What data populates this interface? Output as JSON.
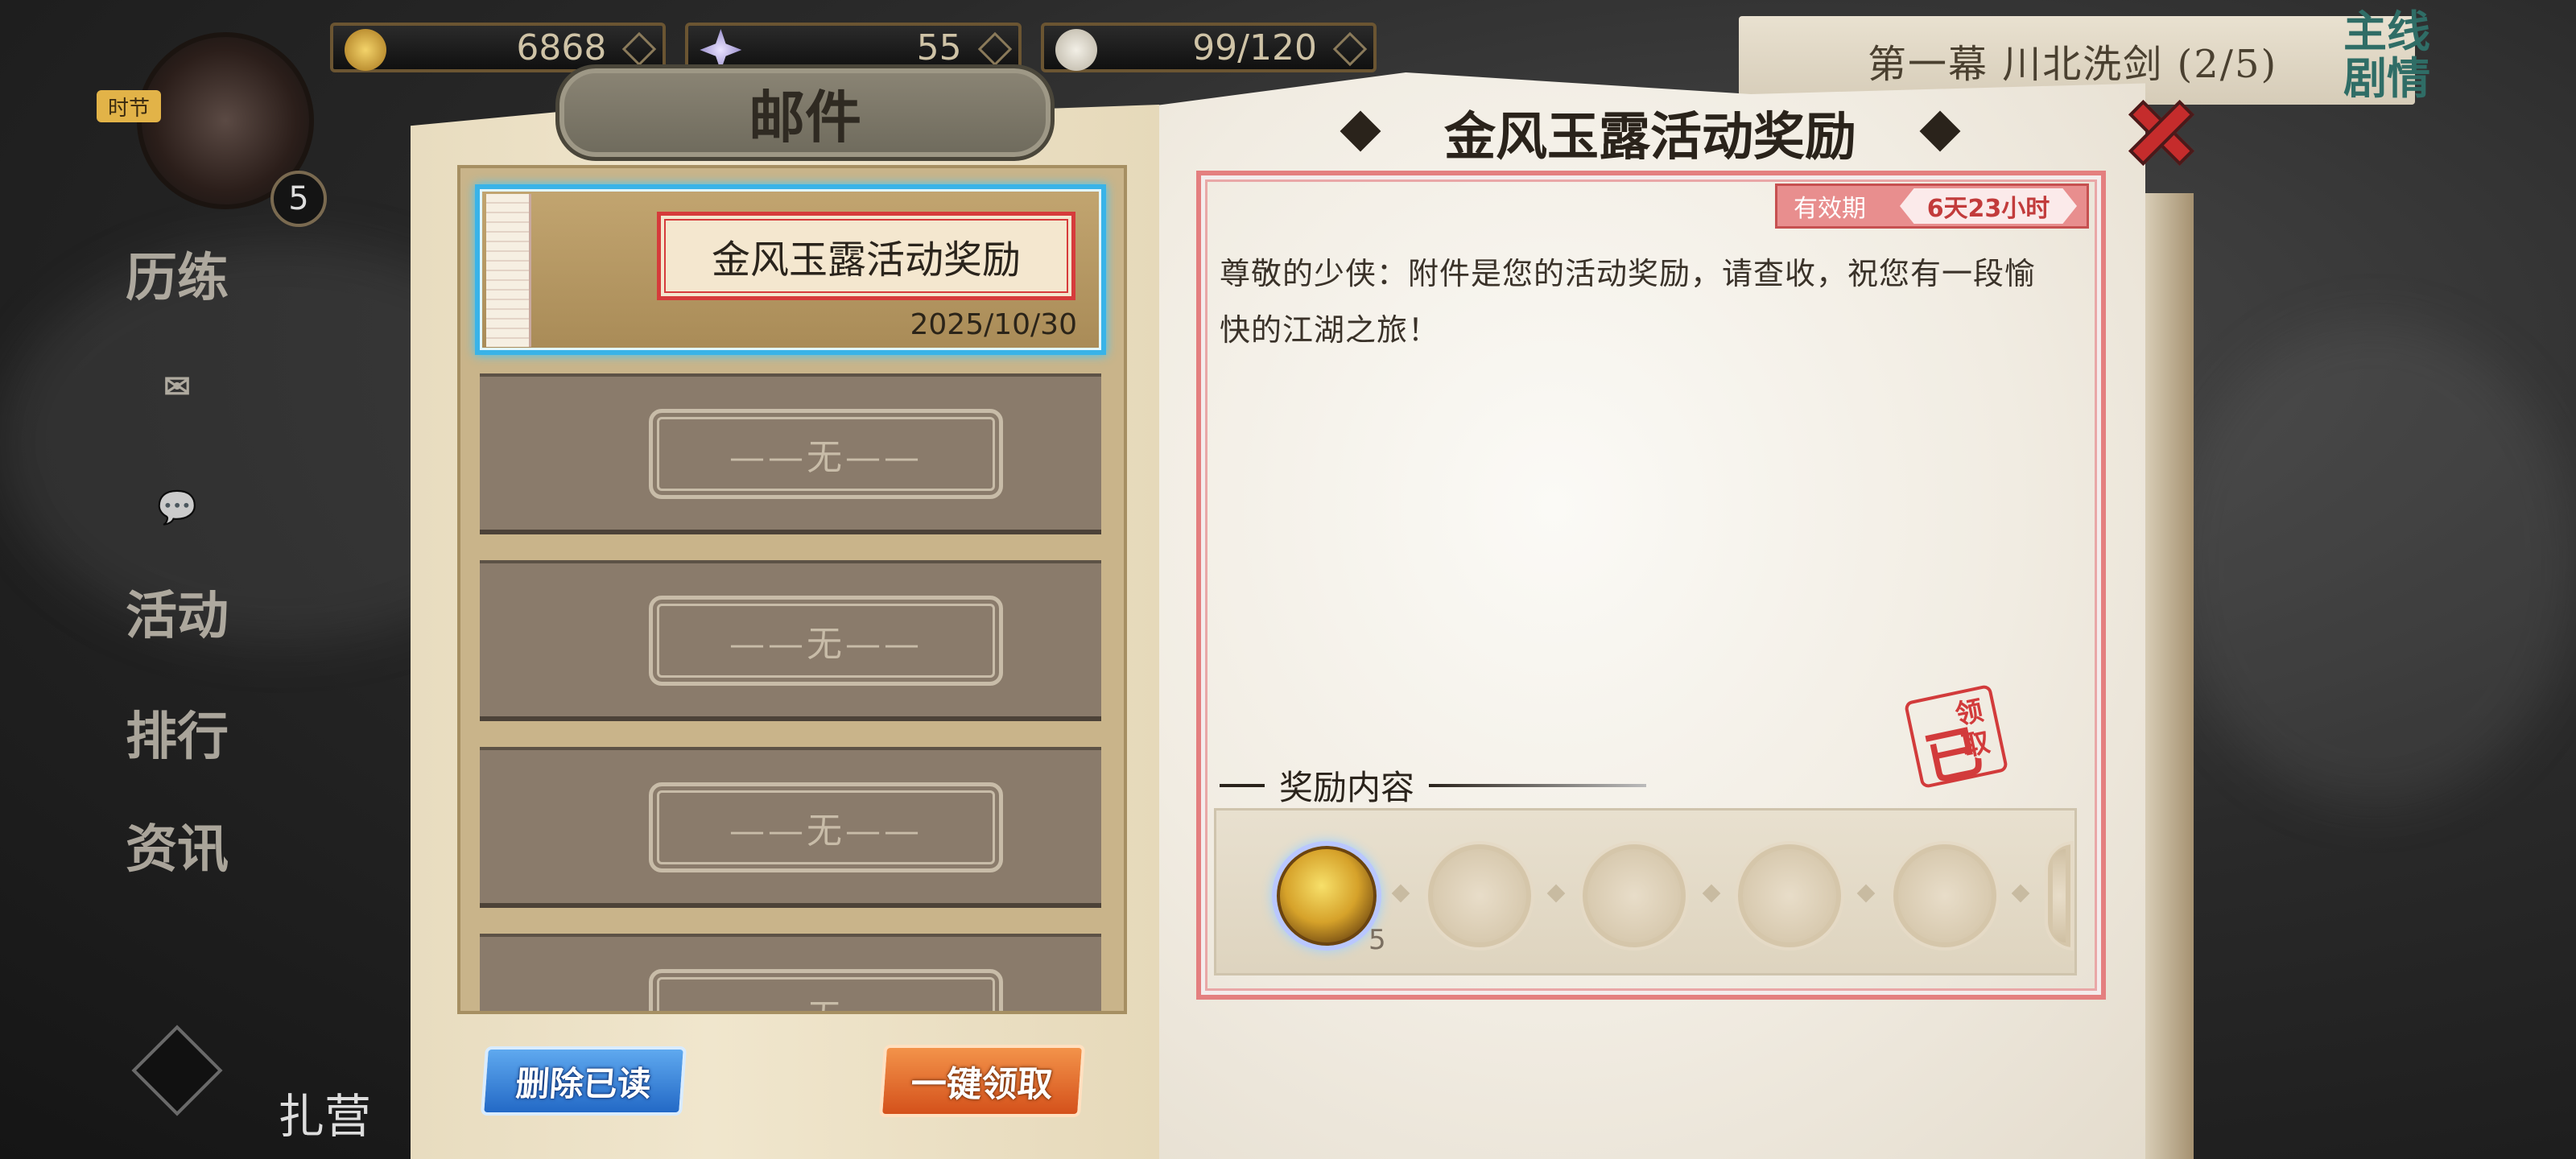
{
  "top_resources": [
    {
      "icon": "coins-icon",
      "value": "6868"
    },
    {
      "icon": "star-crystal-icon",
      "value": "55"
    },
    {
      "icon": "stamina-icon",
      "value": "99/120"
    }
  ],
  "player": {
    "level": "5",
    "time_tag": "时节"
  },
  "side_menu": [
    "历练",
    "信",
    "活动",
    "排行",
    "资讯"
  ],
  "camp_label": "扎营",
  "story": {
    "title": "第一幕 川北洗剑 (2/5)",
    "tag": "主线剧情"
  },
  "mail": {
    "title": "邮件",
    "items": [
      {
        "subject": "金风玉露活动奖励",
        "date": "2025/10/30"
      },
      {
        "empty_label": "——无——"
      },
      {
        "empty_label": "——无——"
      },
      {
        "empty_label": "——无——"
      },
      {
        "empty_label": "——无——"
      }
    ],
    "delete_read_label": "删除已读",
    "claim_all_label": "一键领取"
  },
  "detail": {
    "title": "金风玉露活动奖励",
    "validity_label": "有效期",
    "validity_value": "6天23小时",
    "body": "尊敬的少侠：附件是您的活动奖励，请查收，祝您有一段愉快的江湖之旅！",
    "stamp_left": "已",
    "stamp_right": "领取",
    "reward_header": "奖励内容",
    "rewards": [
      {
        "icon": "gold-token-icon",
        "count": "5"
      }
    ]
  },
  "colors": {
    "selected_border": "#39b3e8",
    "accent_red": "#d63b3b",
    "delete_btn": "#2f7fd8",
    "claim_btn": "#e2672b"
  }
}
